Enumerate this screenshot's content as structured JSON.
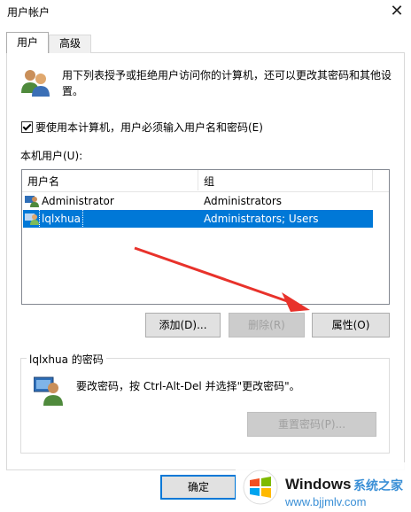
{
  "window": {
    "title": "用户帐户",
    "close_glyph": "✕"
  },
  "tabs": [
    {
      "label": "用户"
    },
    {
      "label": "高级"
    }
  ],
  "description": "用下列表授予或拒绝用户访问你的计算机，还可以更改其密码和其他设置。",
  "require_login": {
    "label": "要使用本计算机，用户必须输入用户名和密码(E)",
    "checked": true
  },
  "local_users_label": "本机用户(U):",
  "users_table": {
    "columns": [
      "用户名",
      "组"
    ],
    "rows": [
      {
        "name": "Administrator",
        "group": "Administrators",
        "selected": false
      },
      {
        "name": "lqlxhua",
        "group": "Administrators; Users",
        "selected": true
      }
    ]
  },
  "buttons": {
    "add": "添加(D)...",
    "delete": "删除(R)",
    "properties": "属性(O)"
  },
  "password_group": {
    "title": "lqlxhua 的密码",
    "text": "要改密码，按 Ctrl-Alt-Del 并选择\"更改密码\"。",
    "reset_button": "重置密码(P)..."
  },
  "ok_button": "确定",
  "watermark": {
    "brand": "Windows",
    "cn": "系统之家",
    "url": "www.bjjmlv.com"
  },
  "colors": {
    "selection": "#0078d7",
    "arrow": "#e8322b",
    "accent": "#3a8fd6"
  }
}
